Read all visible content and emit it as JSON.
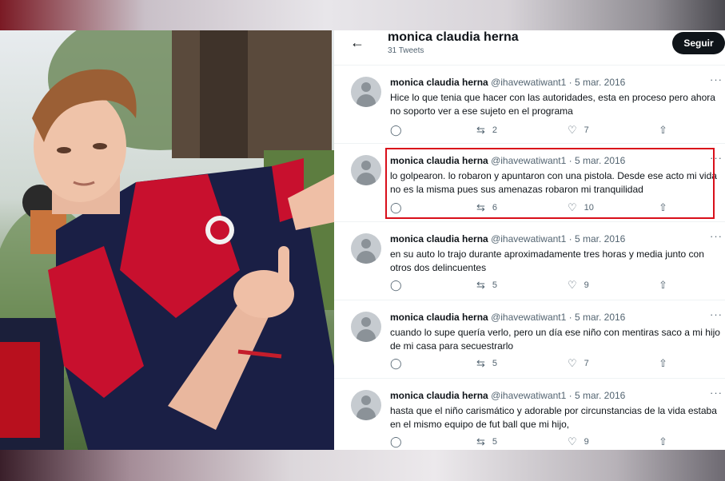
{
  "profile": {
    "name": "monica claudia herna",
    "tweet_count": "31 Tweets",
    "follow_label": "Seguir",
    "back_icon": "back-arrow-icon"
  },
  "tweets": [
    {
      "name": "monica claudia herna",
      "handle": "@ihavewatiwant1",
      "date": "· 5 mar. 2016",
      "text": "Hice lo que tenia que hacer con las autoridades, esta en proceso pero ahora no soporto ver a ese sujeto en el programa",
      "retweets": "2",
      "likes": "7"
    },
    {
      "name": "monica claudia herna",
      "handle": "@ihavewatiwant1",
      "date": "· 5 mar. 2016",
      "text": "lo golpearon. lo robaron y apuntaron con una pistola. Desde ese acto mi vida no es la misma pues sus amenazas robaron mi tranquilidad",
      "retweets": "6",
      "likes": "10"
    },
    {
      "name": "monica claudia herna",
      "handle": "@ihavewatiwant1",
      "date": "· 5 mar. 2016",
      "text": "en su auto lo trajo durante aproximadamente tres horas y media junto con otros dos delincuentes",
      "retweets": "5",
      "likes": "9"
    },
    {
      "name": "monica claudia herna",
      "handle": "@ihavewatiwant1",
      "date": "· 5 mar. 2016",
      "text": "cuando lo supe quería verlo, pero un día ese niño con mentiras saco a mi hijo de mi casa para secuestrarlo",
      "retweets": "5",
      "likes": "7"
    },
    {
      "name": "monica claudia herna",
      "handle": "@ihavewatiwant1",
      "date": "· 5 mar. 2016",
      "text": "hasta que el niño carismático y adorable por circunstancias de la vida estaba en el mismo equipo de fut ball  que mi hijo,",
      "retweets": "5",
      "likes": "9"
    }
  ],
  "colors": {
    "highlight": "#d90f1a",
    "text": "#0f1419",
    "muted": "#536471",
    "follow_bg": "#0f1419"
  }
}
